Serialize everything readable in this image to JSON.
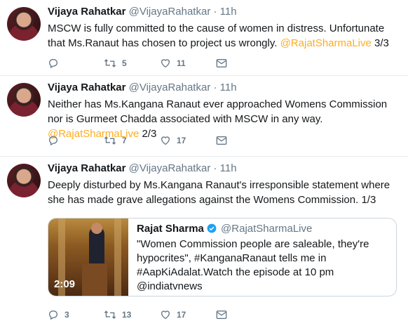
{
  "tweets": [
    {
      "author": "Vijaya Rahatkar",
      "handle": "@VijayaRahatkar",
      "time": "11h",
      "text": "MSCW is fully committed to the cause of women in distress. Unfortunate that Ms.Ranaut has chosen to project us wrongly.",
      "mention": "@RajatSharmaLive",
      "suffix": " 3/3",
      "replies": "",
      "retweets": "5",
      "likes": "11"
    },
    {
      "author": "Vijaya Rahatkar",
      "handle": "@VijayaRahatkar",
      "time": "11h",
      "text": "Neither has Ms.Kangana Ranaut ever approached Womens Commission nor is Gurmeet Chadda associated with MSCW in any way.",
      "mention": "@RajatSharmaLive",
      "suffix": "  2/3",
      "replies": "",
      "retweets": "7",
      "likes": "17"
    },
    {
      "author": "Vijaya Rahatkar",
      "handle": "@VijayaRahatkar",
      "time": "11h",
      "text": "Deeply disturbed by Ms.Kangana Ranaut's irresponsible statement where she has made grave allegations against the Womens Commission. 1/3",
      "replies": "3",
      "retweets": "13",
      "likes": "17",
      "quote": {
        "author": "Rajat Sharma",
        "handle": "@RajatSharmaLive",
        "text": "\"Women Commission people are saleable, they're hypocrites\", #KanganaRanaut tells me in #AapKiAdalat.Watch the episode at 10 pm @indiatvnews",
        "duration": "2:09"
      }
    }
  ],
  "colors": {
    "mention": "#ffad1f",
    "meta": "#657786",
    "verified": "#1da1f2"
  },
  "icons": [
    "reply-icon",
    "retweet-icon",
    "like-icon",
    "message-icon",
    "verified-icon"
  ]
}
